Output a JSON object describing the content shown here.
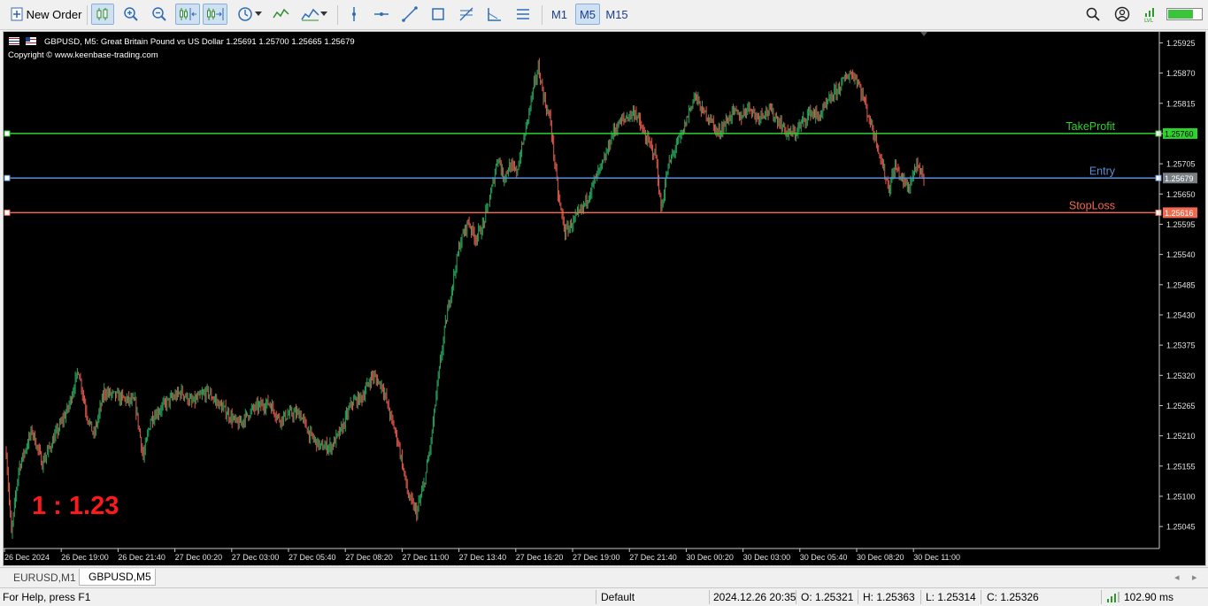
{
  "toolbar": {
    "new_order_label": "New Order",
    "timeframes": [
      "M1",
      "M5",
      "M15"
    ],
    "active_timeframe": "M5"
  },
  "chart": {
    "symbol_info": "GBPUSD, M5:  Great Britain Pound vs US Dollar  1.25691 1.25700 1.25665 1.25679",
    "copyright": "Copyright © www.keenbase-trading.com",
    "ratio_text": "1 : 1.23",
    "lines": {
      "take_profit": {
        "label": "TakeProfit",
        "price": 1.2576,
        "price_label": "1.25760",
        "color": "#2fd12f"
      },
      "entry": {
        "label": "Entry",
        "price": 1.25679,
        "price_label": "1.25679",
        "color": "#5b8ed8"
      },
      "stop_loss": {
        "label": "StopLoss",
        "price": 1.25616,
        "price_label": "1.25616",
        "color": "#f06a50"
      }
    }
  },
  "chart_data": {
    "type": "candlestick",
    "symbol": "GBPUSD",
    "timeframe": "M5",
    "y_ticks": [
      "1.25925",
      "1.25870",
      "1.25815",
      "1.25760",
      "1.25705",
      "1.25650",
      "1.25595",
      "1.25540",
      "1.25485",
      "1.25430",
      "1.25375",
      "1.25320",
      "1.25265",
      "1.25210",
      "1.25155",
      "1.25100",
      "1.25045"
    ],
    "ylim": [
      1.25005,
      1.25945
    ],
    "x_ticks": [
      "26 Dec 2024",
      "26 Dec 19:00",
      "26 Dec 21:40",
      "27 Dec 00:20",
      "27 Dec 03:00",
      "27 Dec 05:40",
      "27 Dec 08:20",
      "27 Dec 11:00",
      "27 Dec 13:40",
      "27 Dec 16:20",
      "27 Dec 19:00",
      "27 Dec 21:40",
      "30 Dec 00:20",
      "30 Dec 03:00",
      "30 Dec 05:40",
      "30 Dec 08:20",
      "30 Dec 11:00"
    ],
    "bull_color": "#26a65b",
    "bear_color": "#e0584a",
    "close_path": [
      [
        0,
        1.2518
      ],
      [
        5,
        1.2503
      ],
      [
        12,
        1.2515
      ],
      [
        25,
        1.2522
      ],
      [
        35,
        1.2516
      ],
      [
        45,
        1.252
      ],
      [
        60,
        1.2526
      ],
      [
        70,
        1.2533
      ],
      [
        78,
        1.2525
      ],
      [
        85,
        1.2521
      ],
      [
        95,
        1.2529
      ],
      [
        110,
        1.2528
      ],
      [
        125,
        1.2527
      ],
      [
        133,
        1.2517
      ],
      [
        140,
        1.2524
      ],
      [
        155,
        1.2527
      ],
      [
        170,
        1.2529
      ],
      [
        180,
        1.2527
      ],
      [
        195,
        1.2529
      ],
      [
        210,
        1.2526
      ],
      [
        225,
        1.2523
      ],
      [
        240,
        1.2526
      ],
      [
        255,
        1.2527
      ],
      [
        265,
        1.2524
      ],
      [
        275,
        1.2525
      ],
      [
        285,
        1.2525
      ],
      [
        295,
        1.2521
      ],
      [
        305,
        1.2519
      ],
      [
        315,
        1.2519
      ],
      [
        325,
        1.2522
      ],
      [
        335,
        1.2527
      ],
      [
        345,
        1.2528
      ],
      [
        355,
        1.2532
      ],
      [
        365,
        1.253
      ],
      [
        372,
        1.2525
      ],
      [
        380,
        1.252
      ],
      [
        390,
        1.251
      ],
      [
        398,
        1.2507
      ],
      [
        405,
        1.2512
      ],
      [
        412,
        1.252
      ],
      [
        418,
        1.253
      ],
      [
        425,
        1.254
      ],
      [
        432,
        1.2548
      ],
      [
        440,
        1.2556
      ],
      [
        448,
        1.256
      ],
      [
        455,
        1.2557
      ],
      [
        462,
        1.2559
      ],
      [
        470,
        1.2565
      ],
      [
        477,
        1.2572
      ],
      [
        482,
        1.2568
      ],
      [
        488,
        1.257
      ],
      [
        495,
        1.2569
      ],
      [
        503,
        1.2576
      ],
      [
        510,
        1.2583
      ],
      [
        516,
        1.2588
      ],
      [
        522,
        1.2582
      ],
      [
        528,
        1.2578
      ],
      [
        535,
        1.2565
      ],
      [
        542,
        1.2558
      ],
      [
        550,
        1.256
      ],
      [
        558,
        1.2562
      ],
      [
        565,
        1.2565
      ],
      [
        572,
        1.2568
      ],
      [
        580,
        1.2571
      ],
      [
        588,
        1.2576
      ],
      [
        595,
        1.2578
      ],
      [
        602,
        1.2579
      ],
      [
        610,
        1.258
      ],
      [
        618,
        1.2576
      ],
      [
        624,
        1.2574
      ],
      [
        630,
        1.2572
      ],
      [
        635,
        1.2562
      ],
      [
        642,
        1.257
      ],
      [
        650,
        1.2574
      ],
      [
        656,
        1.2576
      ],
      [
        662,
        1.258
      ],
      [
        668,
        1.2583
      ],
      [
        675,
        1.258
      ],
      [
        682,
        1.2579
      ],
      [
        690,
        1.2576
      ],
      [
        698,
        1.2578
      ],
      [
        705,
        1.258
      ],
      [
        712,
        1.2579
      ],
      [
        720,
        1.2581
      ],
      [
        728,
        1.2579
      ],
      [
        735,
        1.258
      ],
      [
        742,
        1.258
      ],
      [
        750,
        1.2578
      ],
      [
        758,
        1.2576
      ],
      [
        765,
        1.2576
      ],
      [
        772,
        1.2578
      ],
      [
        780,
        1.258
      ],
      [
        788,
        1.2579
      ],
      [
        795,
        1.2581
      ],
      [
        802,
        1.2583
      ],
      [
        810,
        1.2585
      ],
      [
        818,
        1.2587
      ],
      [
        825,
        1.2586
      ],
      [
        832,
        1.2582
      ],
      [
        838,
        1.2578
      ],
      [
        845,
        1.2574
      ],
      [
        850,
        1.257
      ],
      [
        856,
        1.2566
      ],
      [
        862,
        1.257
      ],
      [
        868,
        1.2568
      ],
      [
        875,
        1.2566
      ],
      [
        882,
        1.257
      ],
      [
        890,
        1.2568
      ]
    ]
  },
  "tabs": {
    "items": [
      "EURUSD,M1",
      "GBPUSD,M5"
    ],
    "active": "GBPUSD,M5"
  },
  "status": {
    "help": "For Help, press F1",
    "profile": "Default",
    "datetime": "2024.12.26 20:35",
    "open": "O: 1.25321",
    "high": "H: 1.25363",
    "low": "L: 1.25314",
    "close": "C: 1.25326",
    "ping": "102.90 ms"
  }
}
